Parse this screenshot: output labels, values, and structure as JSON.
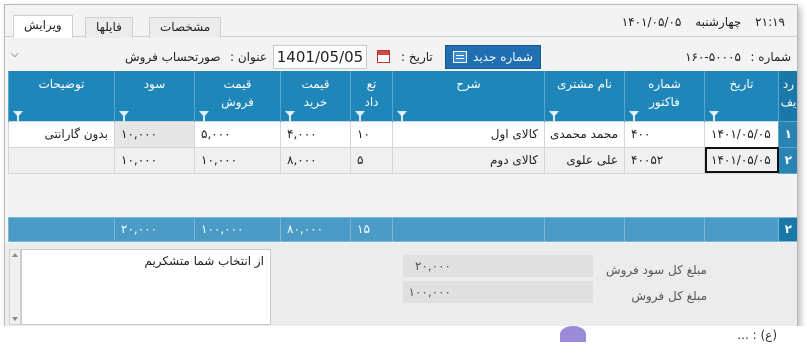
{
  "tabs": [
    {
      "label": "ویرایش",
      "active": true
    },
    {
      "label": "فایلها",
      "active": false
    },
    {
      "label": "مشخصات",
      "active": false
    }
  ],
  "clock": {
    "time": "۲۱:۱۹",
    "day": "چهارشنبه",
    "date": "۱۴۰۱/۰۵/۰۵"
  },
  "header": {
    "number_label": "شماره :",
    "number_value": "۱۶۰-۵۰۰۰۵",
    "new_number_button": "شماره جدید",
    "date_label": "تاریخ :",
    "date_value": "1401/05/05",
    "title_label": "عنوان :",
    "title_value": "صورتحساب فروش"
  },
  "grid": {
    "columns": [
      "ردیف",
      "تاریخ",
      "شماره فاکتور",
      "نام مشتری",
      "شرح",
      "تعداد",
      "قیمت خرید",
      "قیمت فروش",
      "سود",
      "توضیحات"
    ],
    "col_lines": [
      [
        "رد",
        "یف"
      ],
      [
        "تاریخ"
      ],
      [
        "شماره",
        "فاکتور"
      ],
      [
        "نام مشتری"
      ],
      [
        "شرح"
      ],
      [
        "تع",
        "داد"
      ],
      [
        "قیمت",
        "خرید"
      ],
      [
        "قیمت",
        "فروش"
      ],
      [
        "سود"
      ],
      [
        "توضیحات"
      ]
    ],
    "rows": [
      {
        "rownum": "۱",
        "date": "۱۴۰۱/۰۵/۰۵",
        "invoice": "۴۰۰",
        "customer": "محمد محمدی",
        "desc": "کالای اول",
        "qty": "۱۰",
        "buy": "۴,۰۰۰",
        "sell": "۵,۰۰۰",
        "profit": "۱۰,۰۰۰",
        "notes": "بدون گارانتی"
      },
      {
        "rownum": "۲",
        "date": "۱۴۰۱/۰۵/۰۵",
        "invoice": "۴۰۰۵۲",
        "customer": "علی علوی",
        "desc": "کالای دوم",
        "qty": "۵",
        "buy": "۸,۰۰۰",
        "sell": "۱۰,۰۰۰",
        "profit": "۱۰,۰۰۰",
        "notes": ""
      }
    ],
    "footer": {
      "rownum": "۲",
      "qty": "۱۵",
      "buy": "۸۰,۰۰۰",
      "sell": "۱۰۰,۰۰۰",
      "profit": "۲۰,۰۰۰"
    }
  },
  "memo": {
    "text": "از انتخاب شما متشکریم"
  },
  "summary": {
    "total_profit_label": "مبلغ کل سود فروش",
    "total_profit_value": "۲۰,۰۰۰",
    "total_sales_label": "مبلغ کل فروش",
    "total_sales_value": "۱۰۰,۰۰۰"
  },
  "statusbar": {
    "text": "(ع) : ..."
  }
}
